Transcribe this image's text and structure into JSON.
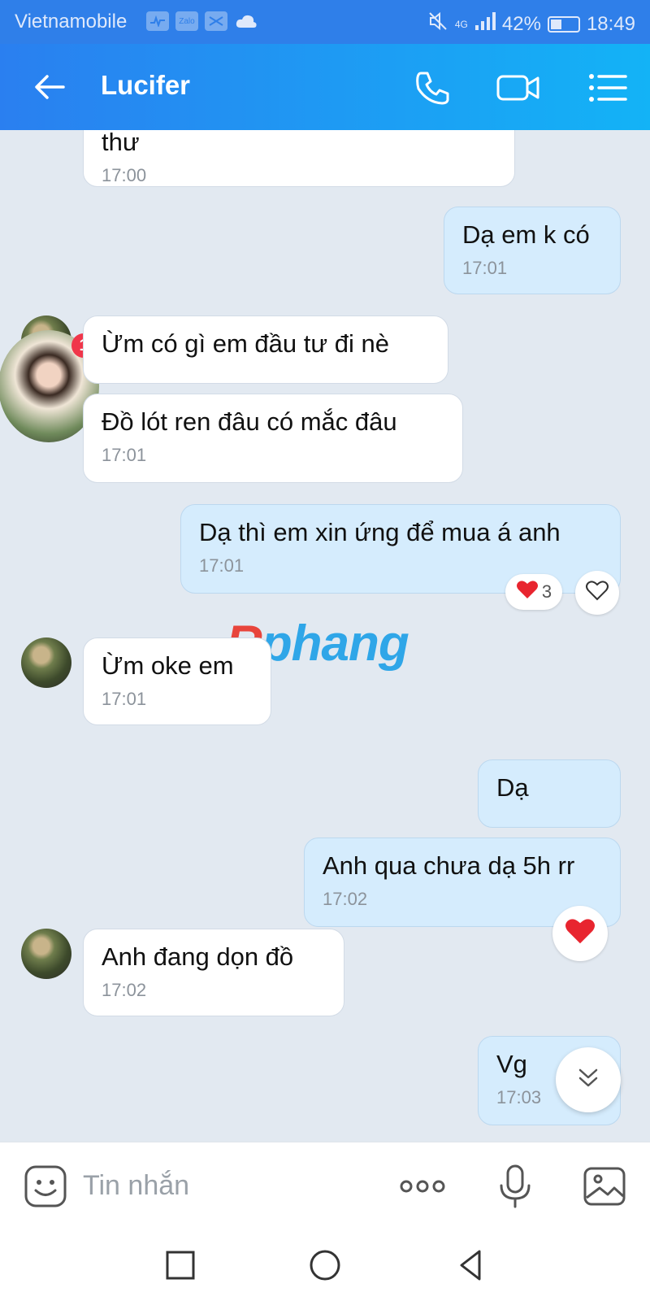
{
  "status_bar": {
    "carrier": "Vietnamobile",
    "network": "4G",
    "battery_percent": "42%",
    "battery_level": 0.42,
    "time": "18:49",
    "icons": [
      "activity-icon",
      "zalo-icon",
      "dots-icon",
      "cloud-icon",
      "mute-icon",
      "signal-icon",
      "battery-icon"
    ]
  },
  "header": {
    "contact_name": "Lucifer",
    "icons": [
      "back-arrow-icon",
      "phone-icon",
      "video-icon",
      "menu-icon"
    ]
  },
  "messages": [
    {
      "side": "in",
      "text": "thư",
      "time": "17:00"
    },
    {
      "side": "out",
      "text": "Dạ em k có",
      "time": "17:01"
    },
    {
      "side": "in",
      "text": "Ừm có gì em đầu tư đi nè",
      "time": ""
    },
    {
      "side": "in",
      "text": "Đồ lót ren đâu có mắc đâu",
      "time": "17:01"
    },
    {
      "side": "out",
      "text": "Dạ thì em xin ứng để mua á anh",
      "time": "17:01"
    },
    {
      "side": "in",
      "text": "Ừm oke em",
      "time": "17:01"
    },
    {
      "side": "out",
      "text": "Dạ",
      "time": ""
    },
    {
      "side": "out",
      "text": "Anh qua chưa dạ 5h rr",
      "time": "17:02"
    },
    {
      "side": "in",
      "text": "Anh đang dọn đồ",
      "time": "17:02"
    },
    {
      "side": "out",
      "text": "Vg",
      "time": "17:03"
    }
  ],
  "reactions": {
    "heart_count": "3"
  },
  "badge": {
    "count": "1"
  },
  "watermark": {
    "first": "R",
    "rest": "phang"
  },
  "input": {
    "placeholder": "Tin nhắn"
  },
  "colors": {
    "header_start": "#2a7ff0",
    "header_end": "#13b3f6",
    "outgoing_bubble": "#d5ecfd",
    "incoming_bubble": "#ffffff",
    "chat_background": "#e2e9f1",
    "heart": "#e8252f"
  }
}
